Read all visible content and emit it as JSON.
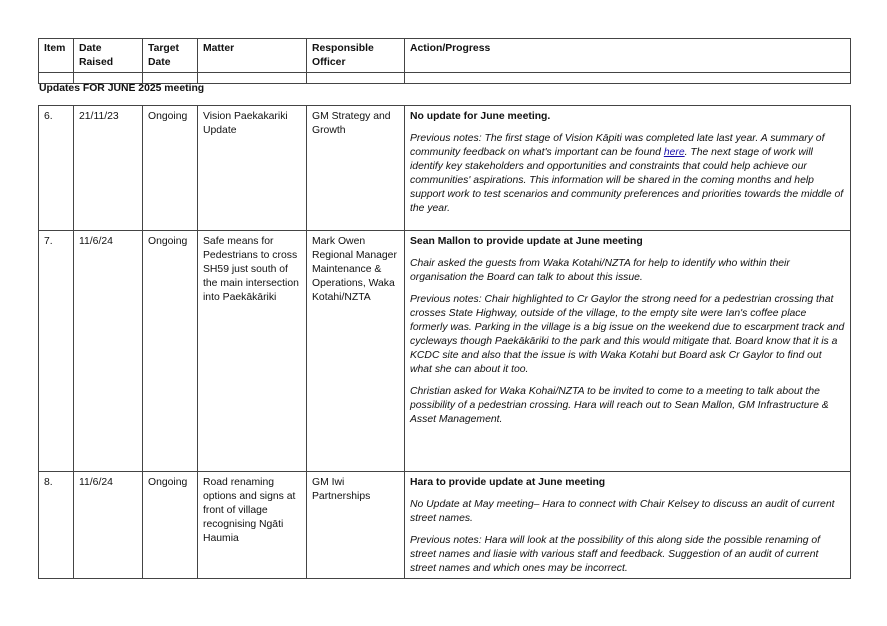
{
  "header": {
    "item": "Item",
    "date_raised": "Date Raised",
    "target_date": "Target Date",
    "matter": "Matter",
    "responsible_officer": "Responsible Officer",
    "action_progress": "Action/Progress"
  },
  "section_heading": "Updates FOR JUNE 2025 meeting",
  "rows": [
    {
      "item": "6.",
      "date_raised": "21/11/23",
      "target_date": "Ongoing",
      "matter": "Vision Paekakariki Update",
      "officer": "GM Strategy and Growth",
      "heading": "No update for June meeting.",
      "para1_before": "Previous notes: The first stage of Vision Kāpiti was completed late last year. A summary of community feedback on what's important can be found ",
      "link": "here",
      "para1_after": ". The next stage of work will identify key stakeholders and opportunities and constraints that could help achieve our communities' aspirations. This information will be shared in the coming months and help support work to test scenarios and community preferences and priorities towards the middle of the year."
    },
    {
      "item": "7.",
      "date_raised": "11/6/24",
      "target_date": "Ongoing",
      "matter": "Safe means for Pedestrians to cross SH59 just south of the main intersection into Paekākāriki",
      "officer": "Mark Owen Regional Manager Maintenance & Operations, Waka Kotahi/NZTA",
      "heading": "Sean Mallon to provide update at June meeting",
      "para1": "Chair asked the guests from Waka Kotahi/NZTA for help to identify who within their organisation the Board can talk to about this issue.",
      "para2": "Previous notes:  Chair highlighted to Cr Gaylor  the strong need for a pedestrian crossing that crosses State Highway, outside of the village, to the empty site were Ian's coffee place formerly was. Parking in the village is a big issue on the weekend due to escarpment track and cycleways though Paekākāriki to the park and this would mitigate that.  Board know that it is a KCDC site and also that the issue is with Waka Kotahi but Board ask Cr Gaylor to find out what she can about it too.",
      "para3": "Christian asked for Waka Kohai/NZTA to be invited to come to a meeting to talk about the possibility of a pedestrian crossing. Hara will reach out to Sean Mallon, GM Infrastructure & Asset Management."
    },
    {
      "item": "8.",
      "date_raised": "11/6/24",
      "target_date": "Ongoing",
      "matter": "Road renaming options and signs at front of village recognising Ngāti Haumia",
      "officer": "GM Iwi Partnerships",
      "heading": "Hara to provide update at June meeting",
      "para1": "No Update at May meeting– Hara to connect with Chair Kelsey to discuss an audit of current street names.",
      "para2": "Previous notes:  Hara will look at the possibility of this along side the possible renaming of street names and liasie with various staff and feedback. Suggestion of an audit of current street names and which ones may be incorrect."
    }
  ]
}
